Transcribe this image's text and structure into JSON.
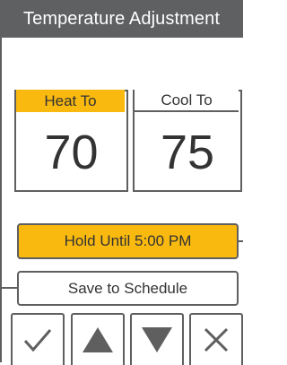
{
  "header": {
    "title": "Temperature Adjustment"
  },
  "heat": {
    "label": "Heat To",
    "value": "70"
  },
  "cool": {
    "label": "Cool To",
    "value": "75"
  },
  "actions": {
    "hold_label": "Hold Until 5:00 PM",
    "save_label": "Save to Schedule"
  },
  "keys": {
    "confirm_icon": "checkmark-icon",
    "up_icon": "up-arrow-icon",
    "down_icon": "down-arrow-icon",
    "cancel_icon": "close-icon"
  },
  "colors": {
    "accent": "#f9b90f",
    "header_bg": "#5f6062",
    "border": "#5f5f5f"
  }
}
